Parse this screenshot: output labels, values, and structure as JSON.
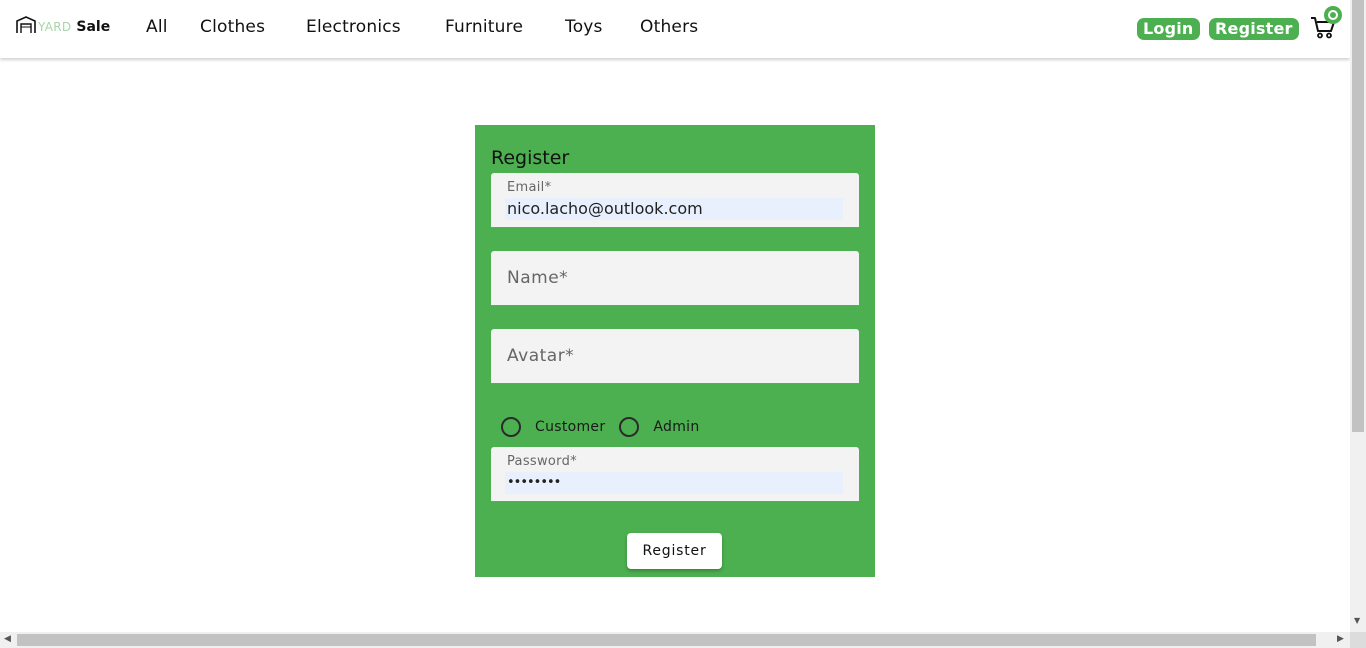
{
  "header": {
    "logo": {
      "yard": "YARD",
      "sale": "Sale",
      "icon": "garage-icon"
    },
    "nav": [
      "All",
      "Clothes",
      "Electronics",
      "Furniture",
      "Toys",
      "Others"
    ],
    "login_label": "Login",
    "register_label": "Register",
    "cart": {
      "icon": "cart-icon",
      "count": "0"
    }
  },
  "form": {
    "title": "Register",
    "email": {
      "label": "Email*",
      "value": "nico.lacho@outlook.com"
    },
    "name": {
      "placeholder": "Name*"
    },
    "avatar": {
      "placeholder": "Avatar*"
    },
    "role_options": [
      "Customer",
      "Admin"
    ],
    "password": {
      "label": "Password*",
      "value": "••••••••"
    },
    "submit_label": "Register"
  },
  "colors": {
    "accent": "#4caf50",
    "autofill": "#e8f0fe",
    "field_bg": "#f3f3f3"
  }
}
